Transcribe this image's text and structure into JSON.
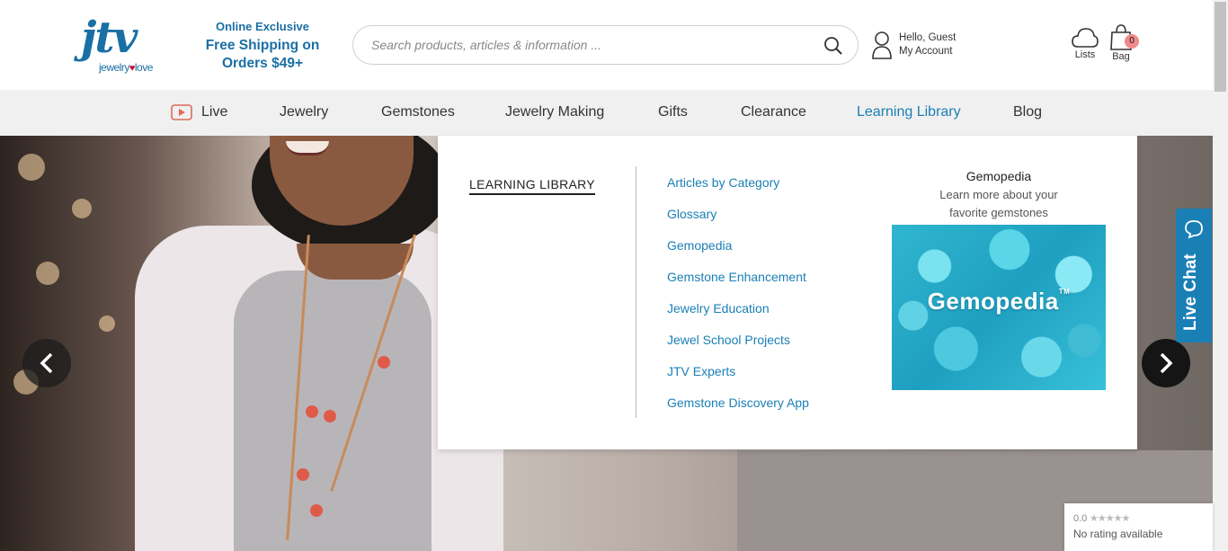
{
  "header": {
    "logo_text": "jtv",
    "logo_tagline_a": "jewelry",
    "logo_tagline_b": "love",
    "promo_line1": "Online Exclusive",
    "promo_line2": "Free Shipping on",
    "promo_line3": "Orders $49+",
    "search_placeholder": "Search products, articles & information ...",
    "account_greeting": "Hello, Guest",
    "account_label": "My Account",
    "lists_label": "Lists",
    "bag_label": "Bag",
    "bag_count": "0"
  },
  "nav": {
    "items": [
      "Live",
      "Jewelry",
      "Gemstones",
      "Jewelry Making",
      "Gifts",
      "Clearance",
      "Learning Library",
      "Blog"
    ],
    "active": "Learning Library"
  },
  "mega_menu": {
    "heading": "LEARNING LIBRARY",
    "links": [
      "Articles by Category",
      "Glossary",
      "Gemopedia",
      "Gemstone Enhancement",
      "Jewelry Education",
      "Jewel School Projects",
      "JTV Experts",
      "Gemstone Discovery App"
    ],
    "promo_title": "Gemopedia",
    "promo_sub1": "Learn more about your",
    "promo_sub2": "favorite gemstones",
    "promo_image_label": "Gemopedia",
    "promo_image_tm": "TM"
  },
  "live_chat": {
    "label": "Live Chat"
  },
  "rating_widget": {
    "score": "0.0",
    "stars": "★★★★★",
    "text": "No rating available"
  },
  "colors": {
    "brand_blue": "#1a7fb5",
    "logo_blue": "#1a6fa5",
    "accent_red": "#c8102e"
  }
}
